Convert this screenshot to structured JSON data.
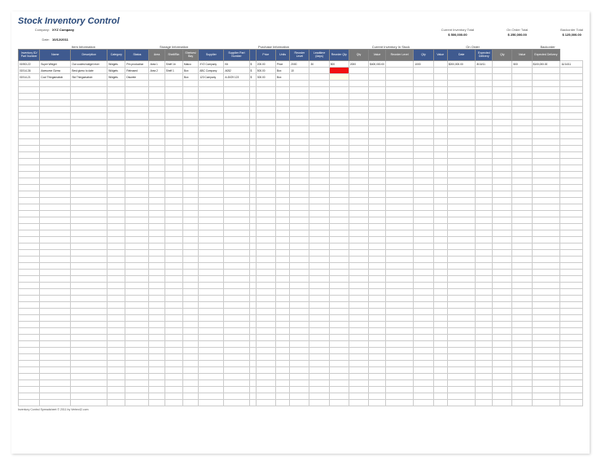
{
  "title": "Stock Inventory Control",
  "company_label": "Company:",
  "company_value": "XYZ Company",
  "date_label": "Date:",
  "date_value": "10/12/2011",
  "summary": [
    {
      "label": "Current Inventory Total",
      "value": "$ 500,000.00"
    },
    {
      "label": "On Order Total",
      "value": "$ 250,000.00"
    },
    {
      "label": "Backorder Total",
      "value": "$ 125,000.00"
    }
  ],
  "sections": [
    {
      "label": "Item Information",
      "span": 5
    },
    {
      "label": "Storage Information",
      "span": 3
    },
    {
      "label": "Purchase Information",
      "span": 8
    },
    {
      "label": "Current Inventory In Stock",
      "span": 4
    },
    {
      "label": "On Order",
      "span": 4
    },
    {
      "label": "Backorder",
      "span": 3
    }
  ],
  "columns": [
    {
      "label": "Inventory ID/ Part Number",
      "tone": "blue"
    },
    {
      "label": "Name",
      "tone": "blue"
    },
    {
      "label": "Description",
      "tone": "blue"
    },
    {
      "label": "Category",
      "tone": "blue"
    },
    {
      "label": "Status",
      "tone": "blue"
    },
    {
      "label": "Area",
      "tone": "gray"
    },
    {
      "label": "Shelf/Bin",
      "tone": "gray"
    },
    {
      "label": "Shelves/ Bay",
      "tone": "gray"
    },
    {
      "label": "Supplier",
      "tone": "blue"
    },
    {
      "label": "Supplier Part Number",
      "tone": "blue"
    },
    {
      "label": "",
      "tone": "blue"
    },
    {
      "label": "Price",
      "tone": "blue"
    },
    {
      "label": "Units",
      "tone": "blue"
    },
    {
      "label": "Reorder Level",
      "tone": "blue"
    },
    {
      "label": "Leadtime (days)",
      "tone": "blue"
    },
    {
      "label": "Reorder Qty",
      "tone": "blue"
    },
    {
      "label": "Qty",
      "tone": "gray"
    },
    {
      "label": "Value",
      "tone": "gray"
    },
    {
      "label": "Reorder Level",
      "tone": "gray"
    },
    {
      "label": "Qty",
      "tone": "blue"
    },
    {
      "label": "Value",
      "tone": "blue"
    },
    {
      "label": "Date",
      "tone": "blue"
    },
    {
      "label": "Expected Delivery",
      "tone": "blue"
    },
    {
      "label": "Qty",
      "tone": "gray"
    },
    {
      "label": "Value",
      "tone": "gray"
    },
    {
      "label": "Expected Delivery",
      "tone": "gray"
    }
  ],
  "rows": [
    [
      "01953-22",
      "Super Widget",
      "Our coolest widget ever",
      "Widgets",
      "Pre-production",
      "Area 1",
      "Shelf 1b",
      "Matco",
      "XYZ Company",
      "Kit",
      "$",
      "200.00",
      "Price",
      "2000",
      "30",
      "500",
      "2000",
      "$400,000.00",
      "",
      "1000",
      "",
      "$200,000.00",
      "8/10/11",
      "",
      "500",
      "$100,000.00",
      "11/14/11"
    ],
    [
      "01914-36",
      "Awesome Gizmo",
      "Best gizmo to date",
      "Widgets",
      "Released",
      "Area 2",
      "Shelf 1",
      "Box",
      "ABC Company",
      "A052",
      "$",
      "500.00",
      "Box",
      "10",
      "",
      "",
      "",
      "",
      "",
      "",
      "",
      "",
      "",
      "",
      "",
      ""
    ],
    [
      "01914-21",
      "Cool Thingamabob",
      "Std Thingamabob",
      "Widgets",
      "Discrete",
      "",
      "",
      "Box",
      "123 Company",
      "A-5X29 123",
      "$",
      "300.00",
      "Box",
      "",
      "",
      "",
      "",
      "",
      "",
      "",
      "",
      "",
      "",
      "",
      "",
      ""
    ]
  ],
  "empty_rows": 50,
  "footer": "Inventory Control Spreadsheet © 2011 by Vertex42.com"
}
